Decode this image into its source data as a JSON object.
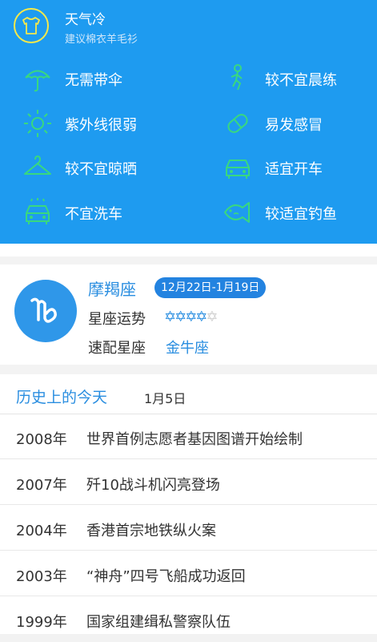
{
  "weather": {
    "title": "天气冷",
    "subtitle": "建议棉衣羊毛衫",
    "tips": [
      {
        "label": "无需带伞",
        "icon": "umbrella-icon"
      },
      {
        "label": "较不宜晨练",
        "icon": "exercise-icon"
      },
      {
        "label": "紫外线很弱",
        "icon": "sun-icon"
      },
      {
        "label": "易发感冒",
        "icon": "pill-icon"
      },
      {
        "label": "较不宜晾晒",
        "icon": "hanger-icon"
      },
      {
        "label": "适宜开车",
        "icon": "car-icon"
      },
      {
        "label": "不宜洗车",
        "icon": "car-wash-icon"
      },
      {
        "label": "较适宜钓鱼",
        "icon": "fish-icon"
      }
    ],
    "accent_color": "#f6e94a"
  },
  "zodiac": {
    "name": "摩羯座",
    "range": "12月22日-1月19日",
    "fortune_label": "星座运势",
    "fortune_stars": 4,
    "fortune_max": 5,
    "match_label": "速配星座",
    "match_value": "金牛座",
    "icon": "capricorn-icon"
  },
  "history": {
    "title": "历史上的今天",
    "date": "1月5日",
    "events": [
      {
        "year": "2008年",
        "text": "世界首例志愿者基因图谱开始绘制"
      },
      {
        "year": "2007年",
        "text": "歼10战斗机闪亮登场"
      },
      {
        "year": "2004年",
        "text": "香港首宗地铁纵火案"
      },
      {
        "year": "2003年",
        "text": "“神舟”四号飞船成功返回"
      },
      {
        "year": "1999年",
        "text": "国家组建缉私警察队伍"
      }
    ]
  },
  "colors": {
    "panel_blue": "#1e9bf0",
    "text_blue": "#2a8ee0",
    "tip_icon_green": "#39d87f"
  }
}
